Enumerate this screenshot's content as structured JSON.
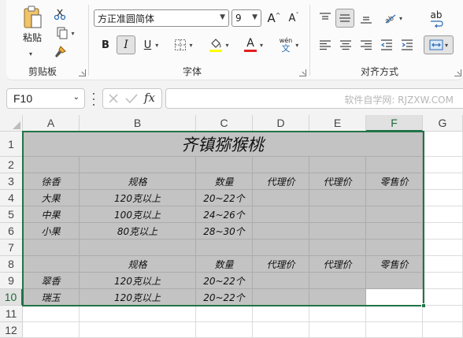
{
  "ribbon": {
    "clipboard": {
      "paste_label": "粘贴",
      "group_label": "剪贴板"
    },
    "font": {
      "font_name": "方正准圆简体",
      "font_size": "9",
      "grow_label": "A",
      "shrink_label": "A",
      "bold_label": "B",
      "italic_label": "I",
      "underline_label": "U",
      "font_color_label": "A",
      "phonetic_top": "wén",
      "phonetic_bottom": "文",
      "group_label": "字体"
    },
    "alignment": {
      "wrap_label": "ab",
      "group_label": "对齐方式"
    }
  },
  "namebox": {
    "value": "F10"
  },
  "formula": {
    "fx_label": "fx",
    "value": ""
  },
  "watermark": "软件自学网: RJZXW.COM",
  "columns": [
    "A",
    "B",
    "C",
    "D",
    "E",
    "F",
    "G"
  ],
  "rows": [
    "1",
    "2",
    "3",
    "4",
    "5",
    "6",
    "7",
    "8",
    "9",
    "10",
    "11",
    "12"
  ],
  "sheet": {
    "title": "齐镇猕猴桃",
    "r3": [
      "徐香",
      "规格",
      "数量",
      "代理价",
      "代理价",
      "零售价"
    ],
    "r4": [
      "大果",
      "120克以上",
      "20~22个",
      "",
      "",
      ""
    ],
    "r5": [
      "中果",
      "100克以上",
      "24~26个",
      "",
      "",
      ""
    ],
    "r6": [
      "小果",
      "80克以上",
      "28~30个",
      "",
      "",
      ""
    ],
    "r8": [
      "",
      "规格",
      "数量",
      "代理价",
      "代理价",
      "零售价"
    ],
    "r9": [
      "翠香",
      "120克以上",
      "20~22个",
      "",
      "",
      ""
    ],
    "r10": [
      "瑞玉",
      "120克以上",
      "20~22个",
      "",
      "",
      ""
    ]
  },
  "colors": {
    "accent": "#217346",
    "fill": "#c3c3c3"
  }
}
